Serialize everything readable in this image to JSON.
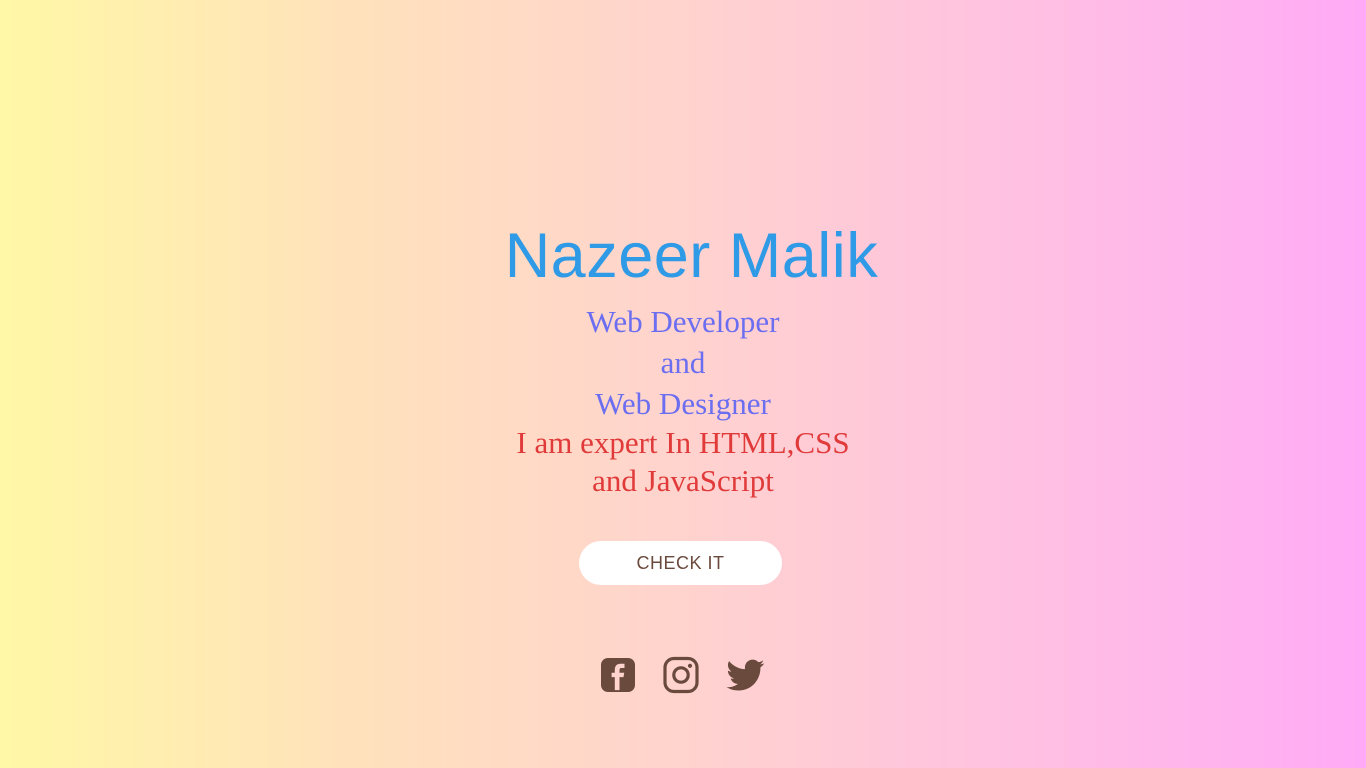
{
  "hero": {
    "name": "Nazeer Malik",
    "role_line_1": "Web Developer",
    "role_line_2": "and",
    "role_line_3": "Web Designer",
    "expert_line_1": "I am expert In HTML,CSS",
    "expert_line_2": "and JavaScript"
  },
  "cta": {
    "label": "CHECK IT"
  },
  "social": [
    {
      "icon": "facebook-icon"
    },
    {
      "icon": "instagram-icon"
    },
    {
      "icon": "twitter-icon"
    }
  ],
  "colors": {
    "name": "#2f9be6",
    "role": "#6b6ef0",
    "expert": "#e03a3a",
    "icon": "#6b4a3e",
    "button_bg": "#ffffff"
  }
}
